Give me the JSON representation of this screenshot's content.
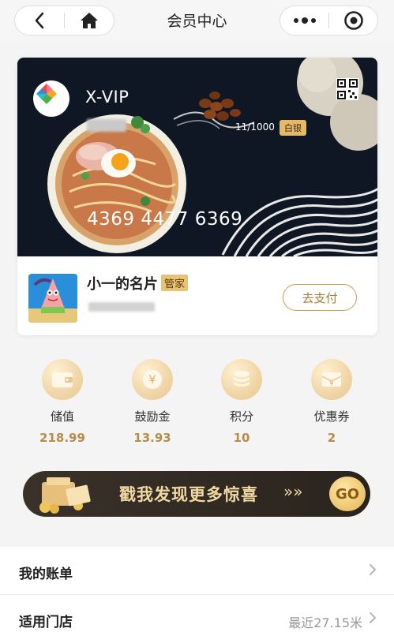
{
  "topbar": {
    "title": "会员中心"
  },
  "card": {
    "tier_name": "X-VIP",
    "progress": "11/1000",
    "level_badge": "白银",
    "card_number": "4369 4477 6369"
  },
  "profile": {
    "name": "小一的名片",
    "role_badge": "管家",
    "pay_button": "去支付"
  },
  "stats": [
    {
      "label": "储值",
      "value": "218.99",
      "icon": "wallet-icon"
    },
    {
      "label": "鼓励金",
      "value": "13.93",
      "icon": "yen-coin-icon"
    },
    {
      "label": "积分",
      "value": "10",
      "icon": "coin-stack-icon"
    },
    {
      "label": "优惠券",
      "value": "2",
      "icon": "coupon-icon"
    }
  ],
  "banner": {
    "text": "戳我发现更多惊喜",
    "arrows": "»»",
    "go_label": "GO"
  },
  "list": [
    {
      "label": "我的账单",
      "extra": ""
    },
    {
      "label": "适用门店",
      "extra": "最近27.15米"
    }
  ],
  "colors": {
    "accent_gold": "#b88c4a",
    "card_bg": "#0f1724",
    "badge_gold": "#e5b969"
  }
}
